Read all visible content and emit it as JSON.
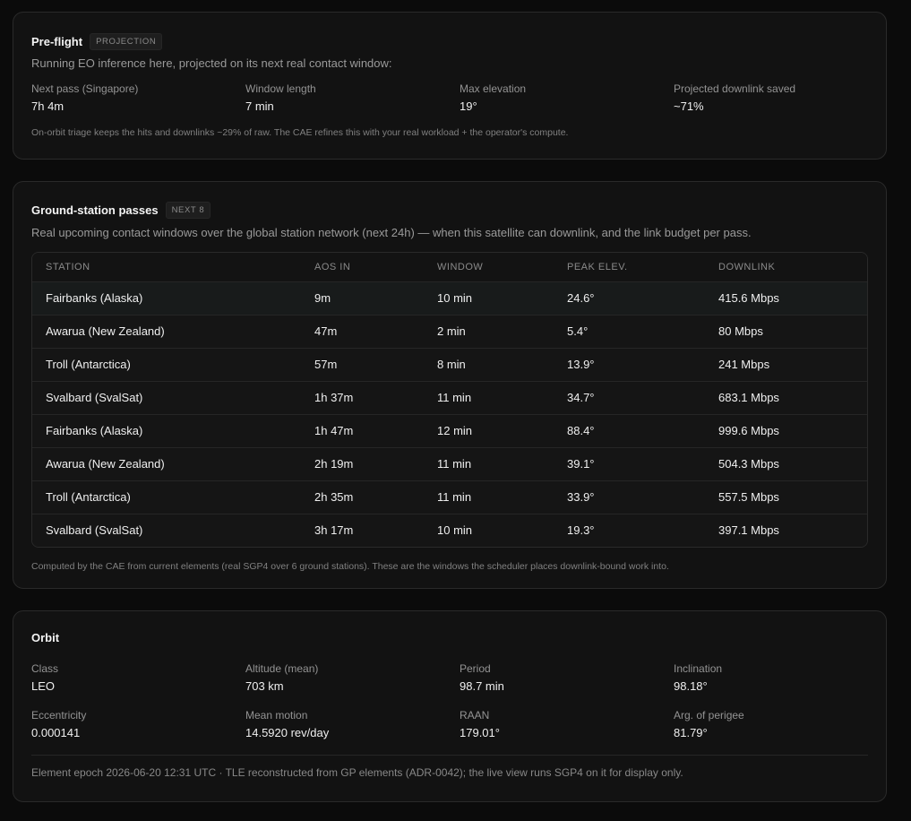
{
  "preflight": {
    "title": "Pre-flight",
    "badge": "PROJECTION",
    "subtitle": "Running EO inference here, projected on its next real contact window:",
    "stats": [
      {
        "label": "Next pass (Singapore)",
        "value": "7h 4m"
      },
      {
        "label": "Window length",
        "value": "7 min"
      },
      {
        "label": "Max elevation",
        "value": "19°"
      },
      {
        "label": "Projected downlink saved",
        "value": "~71%"
      }
    ],
    "note": "On-orbit triage keeps the hits and downlinks ~29% of raw. The CAE refines this with your real workload + the operator's compute."
  },
  "passes": {
    "title": "Ground-station passes",
    "badge": "NEXT 8",
    "subtitle": "Real upcoming contact windows over the global station network (next 24h) — when this satellite can downlink, and the link budget per pass.",
    "columns": [
      "STATION",
      "AOS IN",
      "WINDOW",
      "PEAK ELEV.",
      "DOWNLINK"
    ],
    "rows": [
      [
        "Fairbanks (Alaska)",
        "9m",
        "10 min",
        "24.6°",
        "415.6 Mbps"
      ],
      [
        "Awarua (New Zealand)",
        "47m",
        "2 min",
        "5.4°",
        "80 Mbps"
      ],
      [
        "Troll (Antarctica)",
        "57m",
        "8 min",
        "13.9°",
        "241 Mbps"
      ],
      [
        "Svalbard (SvalSat)",
        "1h 37m",
        "11 min",
        "34.7°",
        "683.1 Mbps"
      ],
      [
        "Fairbanks (Alaska)",
        "1h 47m",
        "12 min",
        "88.4°",
        "999.6 Mbps"
      ],
      [
        "Awarua (New Zealand)",
        "2h 19m",
        "11 min",
        "39.1°",
        "504.3 Mbps"
      ],
      [
        "Troll (Antarctica)",
        "2h 35m",
        "11 min",
        "33.9°",
        "557.5 Mbps"
      ],
      [
        "Svalbard (SvalSat)",
        "3h 17m",
        "10 min",
        "19.3°",
        "397.1 Mbps"
      ]
    ],
    "note": "Computed by the CAE from current elements (real SGP4 over 6 ground stations). These are the windows the scheduler places downlink-bound work into."
  },
  "orbit": {
    "title": "Orbit",
    "stats": [
      {
        "label": "Class",
        "value": "LEO"
      },
      {
        "label": "Altitude (mean)",
        "value": "703 km"
      },
      {
        "label": "Period",
        "value": "98.7 min"
      },
      {
        "label": "Inclination",
        "value": "98.18°"
      },
      {
        "label": "Eccentricity",
        "value": "0.000141"
      },
      {
        "label": "Mean motion",
        "value": "14.5920 rev/day"
      },
      {
        "label": "RAAN",
        "value": "179.01°"
      },
      {
        "label": "Arg. of perigee",
        "value": "81.79°"
      }
    ],
    "epoch": "Element epoch 2026-06-20 12:31 UTC · TLE reconstructed from GP elements (ADR-0042); the live view runs SGP4 on it for display only."
  }
}
